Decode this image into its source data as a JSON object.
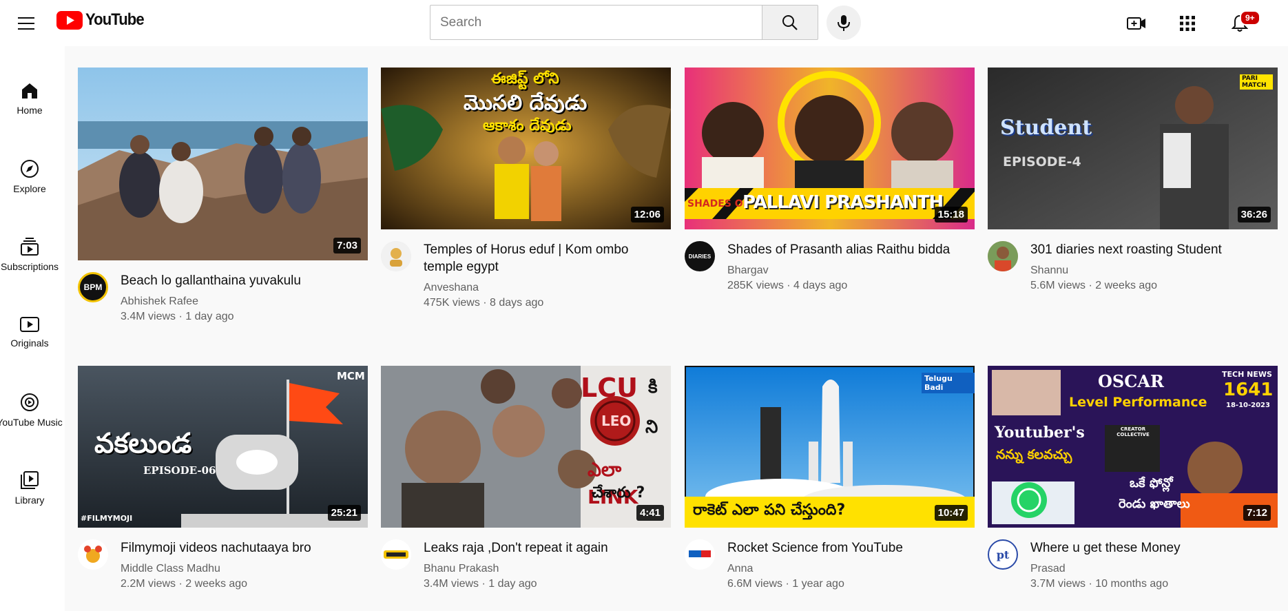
{
  "header": {
    "logo_text": "YouTube",
    "search_placeholder": "Search",
    "notification_count": "9+",
    "icons": [
      "menu-icon",
      "youtube-logo",
      "search-icon",
      "microphone-icon",
      "create-video-icon",
      "apps-grid-icon",
      "bell-icon"
    ]
  },
  "sidebar": {
    "items": [
      {
        "label": "Home",
        "icon": "home-icon"
      },
      {
        "label": "Explore",
        "icon": "compass-icon"
      },
      {
        "label": "Subscriptions",
        "icon": "subscriptions-icon"
      },
      {
        "label": "Originals",
        "icon": "originals-icon"
      },
      {
        "label": "YouTube Music",
        "icon": "music-icon"
      },
      {
        "label": "Library",
        "icon": "library-icon"
      }
    ]
  },
  "videos": [
    {
      "title": "Beach lo gallanthaina yuvakulu",
      "channel": "Abhishek Rafee",
      "stats": "3.4M views · 1 day ago",
      "duration": "7:03",
      "avatar_text": "BPM"
    },
    {
      "title": "Temples of Horus eduf | Kom ombo temple egypt",
      "channel": "Anveshana",
      "stats": "475K views · 8 days ago",
      "duration": "12:06",
      "thumb_text": [
        "ఈజిప్ట్ లోని",
        "మొసలి దేవుడు",
        "ఆకాశం దేవుడు"
      ]
    },
    {
      "title": "Shades of Prasanth alias Raithu bidda",
      "channel": "Bhargav",
      "stats": "285K views · 4 days ago",
      "duration": "15:18",
      "avatar_text": "DIARIES",
      "thumb_text": [
        "SHADES OF",
        "PALLAVI PRASHANTH"
      ]
    },
    {
      "title": "301 diaries next roasting Student",
      "channel": "Shannu",
      "stats": "5.6M views · 2 weeks ago",
      "duration": "36:26",
      "thumb_text": [
        "Student",
        "EPISODE-4",
        "PARI MATCH"
      ]
    },
    {
      "title": "Filmymoji videos nachutaaya bro",
      "channel": "Middle Class Madhu",
      "stats": "2.2M views · 2 weeks ago",
      "duration": "25:21",
      "thumb_text": [
        "వకలుండ",
        "EPISODE-06",
        "#FILMYMOJI",
        "MCM"
      ]
    },
    {
      "title": "Leaks raja ,Don't repeat it again",
      "channel": "Bhanu Prakash",
      "stats": "3.4M views · 1 day ago",
      "duration": "4:41",
      "thumb_text": [
        "LCU",
        "కి",
        "LEO",
        "ని",
        "ఎలా LINK",
        "చేశారు ?"
      ]
    },
    {
      "title": "Rocket Science from YouTube",
      "channel": "Anna",
      "stats": "6.6M views · 1 year ago",
      "duration": "10:47",
      "thumb_text": [
        "Telugu Badi",
        "రాకెట్ ఎలా పని చేస్తుంది?"
      ]
    },
    {
      "title": "Where u get these Money",
      "channel": "Prasad",
      "stats": "3.7M views · 10 months ago",
      "duration": "7:12",
      "avatar_text": "pt",
      "thumb_text": [
        "OSCAR",
        "Level Performance",
        "Youtuber's",
        "నన్ను కలవచ్చు",
        "ఒకే ఫోన్లో",
        "రెండు ఖాతాలు",
        "TECH NEWS",
        "1641",
        "18-10-2023",
        "CREATOR COLLECTIVE"
      ]
    }
  ],
  "colors": {
    "brand_red": "#ff0000",
    "badge_red": "#cc0000",
    "text_secondary": "#606060"
  }
}
